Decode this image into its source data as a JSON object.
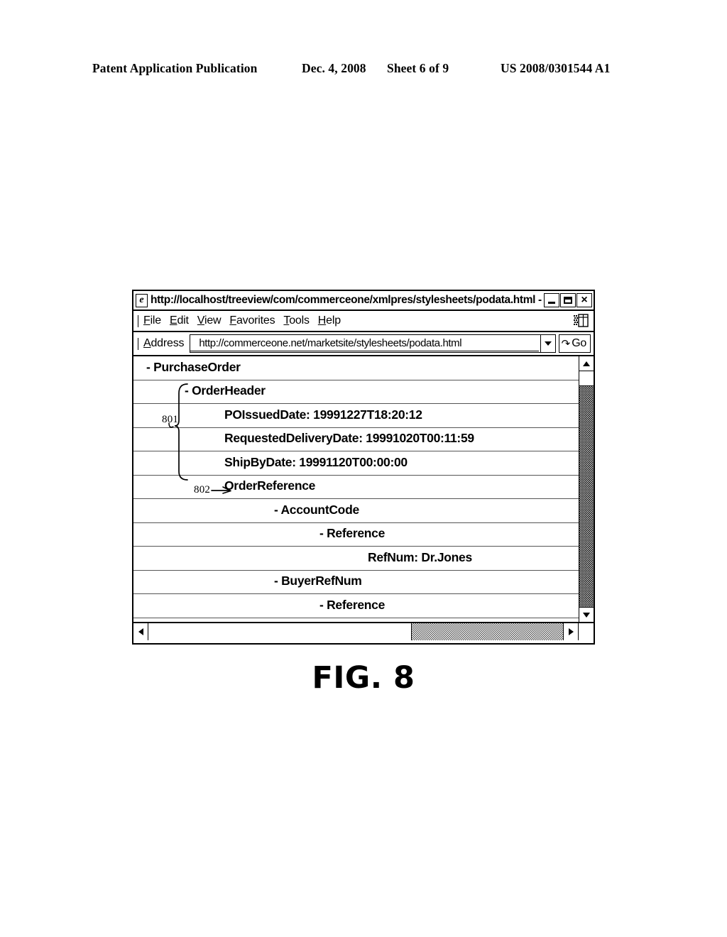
{
  "page_header": {
    "publication": "Patent Application Publication",
    "date": "Dec. 4, 2008",
    "sheet": "Sheet 6 of 9",
    "patent_number": "US 2008/0301544 A1"
  },
  "browser": {
    "title": "http://localhost/treeview/com/commerceone/xmlpres/stylesheets/podata.html - Mic...",
    "icon": "ie-logo-icon",
    "window_buttons": {
      "minimize": "minimize-button",
      "maximize": "maximize-button",
      "close": "×"
    },
    "menu": [
      {
        "label": "File",
        "accel": "F"
      },
      {
        "label": "Edit",
        "accel": "E"
      },
      {
        "label": "View",
        "accel": "V"
      },
      {
        "label": "Favorites",
        "accel": "F"
      },
      {
        "label": "Tools",
        "accel": "T"
      },
      {
        "label": "Help",
        "accel": "H"
      }
    ],
    "address_bar": {
      "label": "Address",
      "value": "http://commerceone.net/marketsite/stylesheets/podata.html",
      "dropdown_icon": "chevron-down-icon",
      "go_button": {
        "label": "Go",
        "icon": "go-arrow-icon",
        "glyph": "↷"
      }
    },
    "scrollbars": {
      "vertical": {
        "up_icon": "scroll-up-arrow-icon",
        "down_icon": "scroll-down-arrow-icon"
      },
      "horizontal": {
        "left_icon": "scroll-left-arrow-icon",
        "right_icon": "scroll-right-arrow-icon"
      }
    }
  },
  "tree": {
    "rows": [
      {
        "text": "- PurchaseOrder",
        "indent": 0
      },
      {
        "text": "- OrderHeader",
        "indent": 1
      },
      {
        "text": "POIssuedDate: 19991227T18:20:12",
        "indent": 2
      },
      {
        "text": "RequestedDeliveryDate: 19991020T00:11:59",
        "indent": 2
      },
      {
        "text": "ShipByDate: 19991120T00:00:00",
        "indent": 2
      },
      {
        "text": "OrderReference",
        "indent": 2
      },
      {
        "text": "- AccountCode",
        "indent": 3
      },
      {
        "text": "- Reference",
        "indent": 4
      },
      {
        "text": "RefNum: Dr.Jones",
        "indent": 5
      },
      {
        "text": "- BuyerRefNum",
        "indent": 3
      },
      {
        "text": "- Reference",
        "indent": 4
      }
    ]
  },
  "callouts": [
    {
      "id": "801",
      "label": "801",
      "target": "order-header-group"
    },
    {
      "id": "802",
      "label": "802",
      "target": "order-reference-row"
    }
  ],
  "figure_caption": "FIG. 8"
}
